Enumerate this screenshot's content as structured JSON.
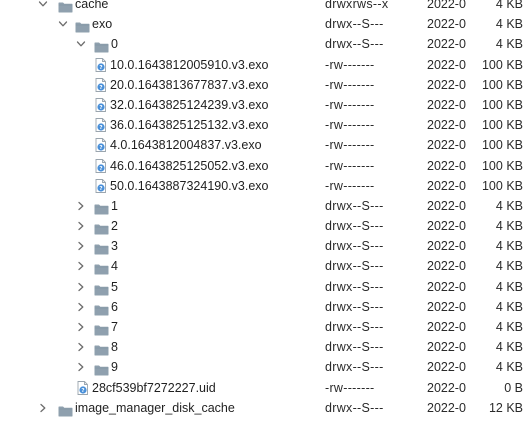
{
  "rows": [
    {
      "name": "cache",
      "perm": "drwxrws--x",
      "date": "2022-0",
      "size": "4 KB",
      "type": "folder",
      "expanded": true,
      "depth": 0
    },
    {
      "name": "exo",
      "perm": "drwx--S---",
      "date": "2022-0",
      "size": "4 KB",
      "type": "folder",
      "expanded": true,
      "depth": 1
    },
    {
      "name": "0",
      "perm": "drwx--S---",
      "date": "2022-0",
      "size": "4 KB",
      "type": "folder",
      "expanded": true,
      "depth": 2
    },
    {
      "name": "10.0.1643812005910.v3.exo",
      "perm": "-rw-------",
      "date": "2022-0",
      "size": "100 KB",
      "type": "file",
      "depth": 3
    },
    {
      "name": "20.0.1643813677837.v3.exo",
      "perm": "-rw-------",
      "date": "2022-0",
      "size": "100 KB",
      "type": "file",
      "depth": 3
    },
    {
      "name": "32.0.1643825124239.v3.exo",
      "perm": "-rw-------",
      "date": "2022-0",
      "size": "100 KB",
      "type": "file",
      "depth": 3
    },
    {
      "name": "36.0.1643825125132.v3.exo",
      "perm": "-rw-------",
      "date": "2022-0",
      "size": "100 KB",
      "type": "file",
      "depth": 3
    },
    {
      "name": "4.0.1643812004837.v3.exo",
      "perm": "-rw-------",
      "date": "2022-0",
      "size": "100 KB",
      "type": "file",
      "depth": 3
    },
    {
      "name": "46.0.1643825125052.v3.exo",
      "perm": "-rw-------",
      "date": "2022-0",
      "size": "100 KB",
      "type": "file",
      "depth": 3
    },
    {
      "name": "50.0.1643887324190.v3.exo",
      "perm": "-rw-------",
      "date": "2022-0",
      "size": "100 KB",
      "type": "file",
      "depth": 3
    },
    {
      "name": "1",
      "perm": "drwx--S---",
      "date": "2022-0",
      "size": "4 KB",
      "type": "folder",
      "expanded": false,
      "depth": 2
    },
    {
      "name": "2",
      "perm": "drwx--S---",
      "date": "2022-0",
      "size": "4 KB",
      "type": "folder",
      "expanded": false,
      "depth": 2
    },
    {
      "name": "3",
      "perm": "drwx--S---",
      "date": "2022-0",
      "size": "4 KB",
      "type": "folder",
      "expanded": false,
      "depth": 2
    },
    {
      "name": "4",
      "perm": "drwx--S---",
      "date": "2022-0",
      "size": "4 KB",
      "type": "folder",
      "expanded": false,
      "depth": 2
    },
    {
      "name": "5",
      "perm": "drwx--S---",
      "date": "2022-0",
      "size": "4 KB",
      "type": "folder",
      "expanded": false,
      "depth": 2
    },
    {
      "name": "6",
      "perm": "drwx--S---",
      "date": "2022-0",
      "size": "4 KB",
      "type": "folder",
      "expanded": false,
      "depth": 2
    },
    {
      "name": "7",
      "perm": "drwx--S---",
      "date": "2022-0",
      "size": "4 KB",
      "type": "folder",
      "expanded": false,
      "depth": 2
    },
    {
      "name": "8",
      "perm": "drwx--S---",
      "date": "2022-0",
      "size": "4 KB",
      "type": "folder",
      "expanded": false,
      "depth": 2
    },
    {
      "name": "9",
      "perm": "drwx--S---",
      "date": "2022-0",
      "size": "4 KB",
      "type": "folder",
      "expanded": false,
      "depth": 2
    },
    {
      "name": "28cf539bf7272227.uid",
      "perm": "-rw-------",
      "date": "2022-0",
      "size": "0 B",
      "type": "file",
      "depth": 2
    },
    {
      "name": "image_manager_disk_cache",
      "perm": "drwx--S---",
      "date": "2022-0",
      "size": "12 KB",
      "type": "folder",
      "expanded": false,
      "depth": 0
    }
  ],
  "colors": {
    "folder": "#8fa0ae",
    "folder_tab": "#7d8f9e",
    "file_badge": "#4a90d9",
    "chevron": "#6d6d6d"
  },
  "icons": {
    "folder": "folder-icon",
    "file": "unknown-file-icon",
    "expanded": "chevron-down-icon",
    "collapsed": "chevron-right-icon"
  }
}
